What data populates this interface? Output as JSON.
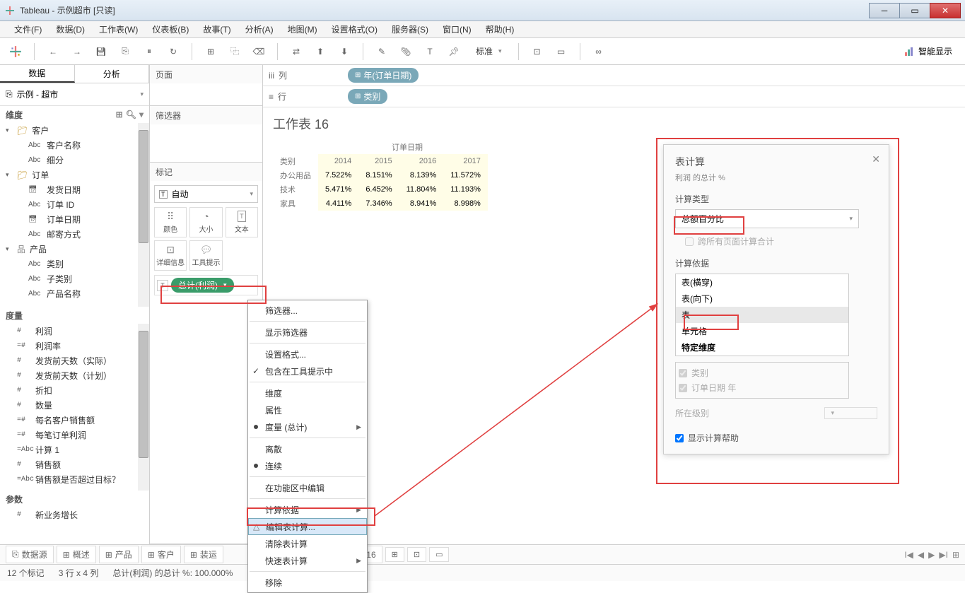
{
  "window": {
    "title": "Tableau - 示例超市 [只读]"
  },
  "menu": {
    "items": [
      "文件(F)",
      "数据(D)",
      "工作表(W)",
      "仪表板(B)",
      "故事(T)",
      "分析(A)",
      "地图(M)",
      "设置格式(O)",
      "服务器(S)",
      "窗口(N)",
      "帮助(H)"
    ]
  },
  "toolbar": {
    "standard_label": "标准",
    "smart_display_label": "智能显示"
  },
  "sidebar": {
    "tabs": {
      "data": "数据",
      "analysis": "分析"
    },
    "datasource": "示例 - 超市",
    "dimensions_label": "维度",
    "measures_label": "度量",
    "parameters_label": "参数",
    "dimensions": {
      "customer": {
        "label": "客户",
        "children": [
          "客户名称",
          "细分"
        ]
      },
      "order": {
        "label": "订单",
        "children": [
          "发货日期",
          "订单 ID",
          "订单日期",
          "邮寄方式"
        ]
      },
      "product": {
        "label": "产品",
        "children": [
          "类别",
          "子类别",
          "产品名称"
        ]
      }
    },
    "measures": [
      "利润",
      "利润率",
      "发货前天数（实际）",
      "发货前天数（计划）",
      "折扣",
      "数量",
      "每名客户销售额",
      "每笔订单利润",
      "计算 1",
      "销售额",
      "销售额是否超过目标？"
    ],
    "parameters": [
      "新业务增长"
    ]
  },
  "panels": {
    "pages_label": "页面",
    "filters_label": "筛选器",
    "marks_label": "标记",
    "marks_type": "自动",
    "marks_cells": {
      "color": "颜色",
      "size": "大小",
      "text": "文本",
      "detail": "详细信息",
      "tooltip": "工具提示"
    },
    "mark_pill": "总计(利润)"
  },
  "shelves": {
    "columns_label": "列",
    "rows_label": "行",
    "col_pill": "年(订单日期)",
    "row_pill": "类别"
  },
  "sheet": {
    "title": "工作表 16",
    "column_header": "订单日期"
  },
  "chart_data": {
    "type": "table",
    "row_header": "类别",
    "columns": [
      "2014",
      "2015",
      "2016",
      "2017"
    ],
    "rows": [
      {
        "label": "办公用品",
        "values": [
          "7.522%",
          "8.151%",
          "8.139%",
          "11.572%"
        ]
      },
      {
        "label": "技术",
        "values": [
          "5.471%",
          "6.452%",
          "11.804%",
          "11.193%"
        ]
      },
      {
        "label": "家具",
        "values": [
          "4.411%",
          "7.346%",
          "8.941%",
          "8.998%"
        ]
      }
    ]
  },
  "context_menu": {
    "filter": "筛选器...",
    "show_filter": "显示筛选器",
    "format": "设置格式...",
    "include_tooltip": "包含在工具提示中",
    "dimension": "维度",
    "attribute": "属性",
    "measure_agg": "度量 (总计)",
    "discrete": "离散",
    "continuous": "连续",
    "edit_in_shelf": "在功能区中编辑",
    "compute_using": "计算依据",
    "edit_table_calc": "编辑表计算...",
    "clear_table_calc": "清除表计算",
    "quick_table_calc": "快速表计算",
    "remove": "移除"
  },
  "dialog": {
    "title": "表计算",
    "subtitle": "利润 的总计 %",
    "calc_type_label": "计算类型",
    "calc_type_value": "总额百分比",
    "sum_across_pages": "跨所有页面计算合计",
    "compute_using_label": "计算依据",
    "options": [
      "表(横穿)",
      "表(向下)",
      "表",
      "单元格",
      "特定维度"
    ],
    "selected_option": "表",
    "dims": [
      "类别",
      "订单日期 年"
    ],
    "level_label": "所在级别",
    "show_help": "显示计算帮助"
  },
  "sheet_tabs": {
    "datasource": "数据源",
    "tabs": [
      "概述",
      "产品",
      "客户",
      "装运"
    ],
    "current": "工作表 16"
  },
  "status": {
    "marks": "12 个标记",
    "dims": "3 行 x 4 列",
    "agg": "总计(利润) 的总计 %: 100.000%"
  }
}
